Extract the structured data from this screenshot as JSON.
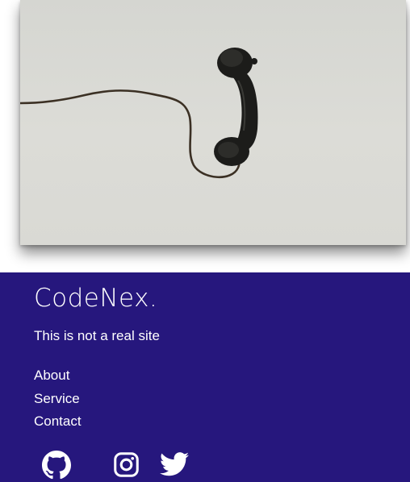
{
  "hero": {
    "image": "telephone-handset-photo",
    "colors": {
      "background": "#d9d9d4",
      "handset": "#1c1c1a",
      "cord": "#3b3024"
    }
  },
  "footer": {
    "background": "#26177d",
    "brand": "CodeNex.",
    "tagline": "This is not a real site",
    "nav": [
      {
        "label": "About"
      },
      {
        "label": "Service"
      },
      {
        "label": "Contact"
      }
    ],
    "socials": [
      {
        "icon": "github-icon"
      },
      {
        "icon": "instagram-icon"
      },
      {
        "icon": "twitter-icon"
      }
    ]
  }
}
